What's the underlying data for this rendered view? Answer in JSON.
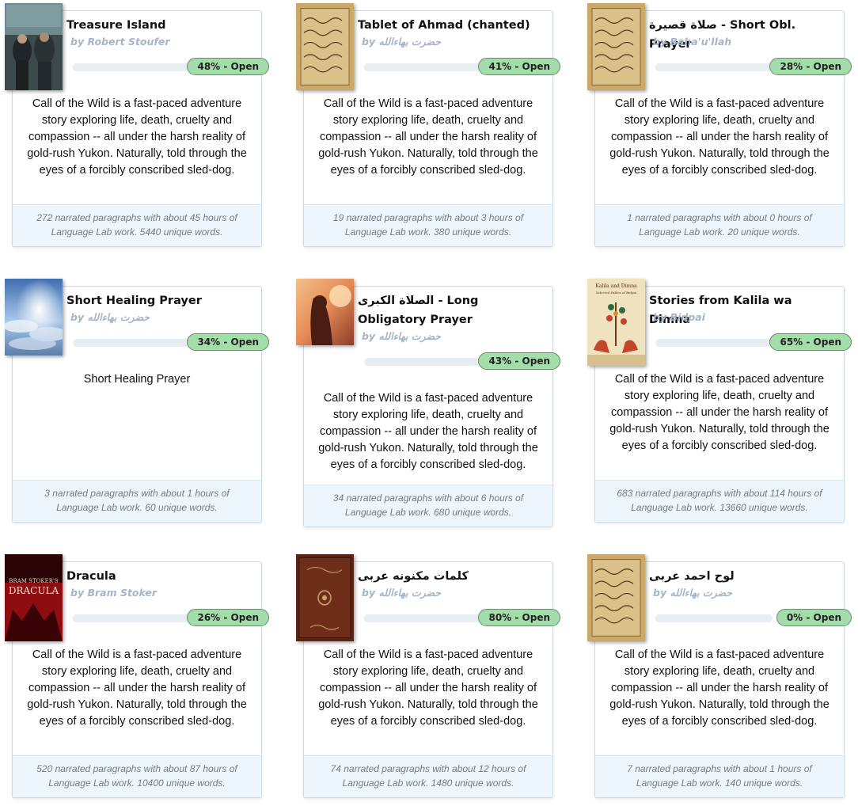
{
  "books": [
    {
      "title": "Treasure Island",
      "author": "by Robert Stoufer",
      "progress": 0.48,
      "badge": "48% - Open",
      "cover": "treasure-island-cover",
      "description": "Call of the Wild is a fast-paced adventure story exploring life, death, cruelty and compassion -- all under the harsh reality of gold-rush Yukon. Naturally, told through the eyes of a forcibly conscribed sled-dog.",
      "footer_line1": "272 narrated paragraphs with about 45 hours of",
      "footer_line2": "Language Lab work. 5440 unique words."
    },
    {
      "title": "Tablet of Ahmad (chanted)",
      "author": "by حضرت بهاءالله",
      "progress": 0.41,
      "badge": "41% - Open",
      "cover": "calligraphy-manuscript-cover",
      "description": "Call of the Wild is a fast-paced adventure story exploring life, death, cruelty and compassion -- all under the harsh reality of gold-rush Yukon. Naturally, told through the eyes of a forcibly conscribed sled-dog.",
      "footer_line1": "19 narrated paragraphs with about 3 hours of",
      "footer_line2": "Language Lab work. 380 unique words."
    },
    {
      "title": "صلاة قصيرة - Short Obl. Prayer",
      "author": "by Baha'u'llah",
      "progress": 0.28,
      "badge": "28% - Open",
      "cover": "calligraphy-manuscript-cover",
      "description": "Call of the Wild is a fast-paced adventure story exploring life, death, cruelty and compassion -- all under the harsh reality of gold-rush Yukon. Naturally, told through the eyes of a forcibly conscribed sled-dog.",
      "footer_line1": "1 narrated paragraphs with about 0 hours of",
      "footer_line2": "Language Lab work. 20 unique words."
    },
    {
      "title": "Short Healing Prayer",
      "author": "by حضرت بهاءالله",
      "progress": 0.34,
      "badge": "34% - Open",
      "cover": "sky-clouds-cover",
      "description": "Short Healing Prayer",
      "footer_line1": "3 narrated paragraphs with about 1 hours of",
      "footer_line2": "Language Lab work. 60 unique words."
    },
    {
      "title": "الصلاة الكبرى - Long Obligatory Prayer",
      "author": "by حضرت بهاءالله",
      "progress": 0.43,
      "badge": "43% - Open",
      "cover": "sunset-silhouette-cover",
      "description": "Call of the Wild is a fast-paced adventure story exploring life, death, cruelty and compassion -- all under the harsh reality of gold-rush Yukon. Naturally, told through the eyes of a forcibly conscribed sled-dog.",
      "footer_line1": "34 narrated paragraphs with about 6 hours of",
      "footer_line2": "Language Lab work. 680 unique words."
    },
    {
      "title": "Stories from Kalila wa Dimna",
      "author": "by Bidpai",
      "progress": 0.65,
      "badge": "65% - Open",
      "cover": "kalila-dimna-cover",
      "cover_title": "Kalila and Dimna",
      "cover_subtitle": "Selected Fables of Bidpai",
      "description": "Call of the Wild is a fast-paced adventure story exploring life, death, cruelty and compassion -- all under the harsh reality of gold-rush Yukon. Naturally, told through the eyes of a forcibly conscribed sled-dog.",
      "footer_line1": "683 narrated paragraphs with about 114 hours of",
      "footer_line2": "Language Lab work. 13660 unique words."
    },
    {
      "title": "Dracula",
      "author": "by Bram Stoker",
      "progress": 0.26,
      "badge": "26% - Open",
      "cover": "dracula-cover",
      "cover_title": "DRACULA",
      "cover_author": "BRAM STOKER'S",
      "description": "Call of the Wild is a fast-paced adventure story exploring life, death, cruelty and compassion -- all under the harsh reality of gold-rush Yukon. Naturally, told through the eyes of a forcibly conscribed sled-dog.",
      "footer_line1": "520 narrated paragraphs with about 87 hours of",
      "footer_line2": "Language Lab work. 10400 unique words."
    },
    {
      "title": "كلمات مكنونه عربى",
      "author": "by حضرت بهاءالله",
      "progress": 0.8,
      "badge": "80% - Open",
      "cover": "leather-book-cover",
      "description": "Call of the Wild is a fast-paced adventure story exploring life, death, cruelty and compassion -- all under the harsh reality of gold-rush Yukon. Naturally, told through the eyes of a forcibly conscribed sled-dog.",
      "footer_line1": "74 narrated paragraphs with about 12 hours of",
      "footer_line2": "Language Lab work. 1480 unique words."
    },
    {
      "title": "لوح احمد عربى",
      "author": "by حضرت بهاءالله",
      "progress": 0.0,
      "badge": "0% - Open",
      "cover": "calligraphy-manuscript-cover",
      "description": "Call of the Wild is a fast-paced adventure story exploring life, death, cruelty and compassion -- all under the harsh reality of gold-rush Yukon. Naturally, told through the eyes of a forcibly conscribed sled-dog.",
      "footer_line1": "7 narrated paragraphs with about 1 hours of",
      "footer_line2": "Language Lab work. 140 unique words."
    }
  ]
}
